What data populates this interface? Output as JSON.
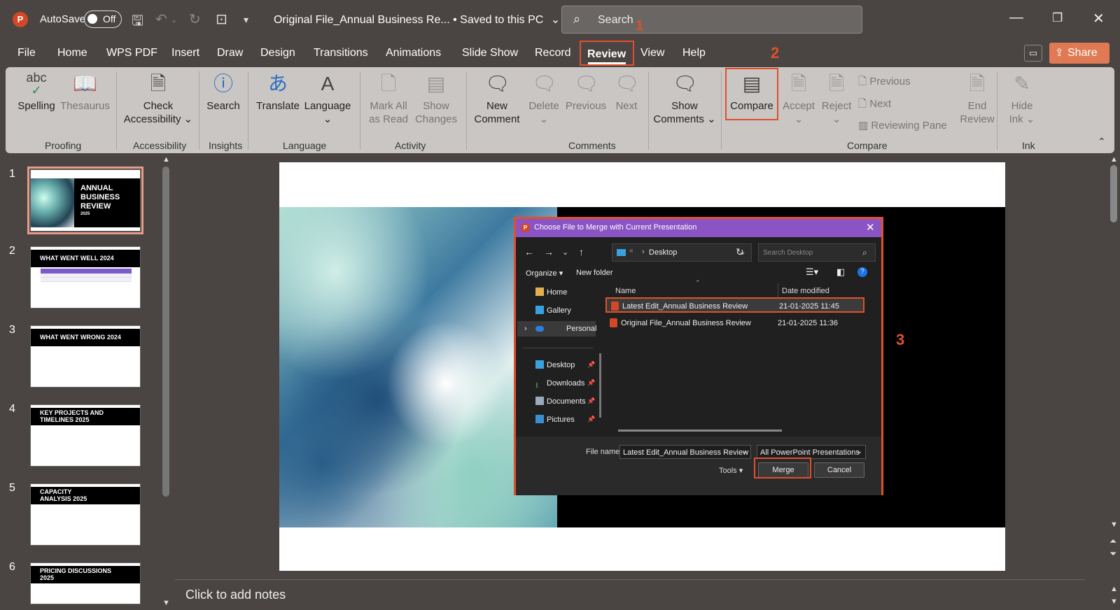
{
  "titlebar": {
    "app_logo": "P",
    "autosave_label": "AutoSave",
    "autosave_state": "Off",
    "doc_title": "Original File_Annual Business Re...  •  Saved to this PC",
    "search_placeholder": "Search",
    "annotation": "1"
  },
  "menu": {
    "tabs": [
      "File",
      "Home",
      "WPS PDF",
      "Insert",
      "Draw",
      "Design",
      "Transitions",
      "Animations",
      "Slide Show",
      "Record",
      "Review",
      "View",
      "Help"
    ],
    "active": "Review",
    "share_label": "Share",
    "annotation": "2"
  },
  "ribbon": {
    "groups": {
      "proofing": "Proofing",
      "accessibility": "Accessibility",
      "insights": "Insights",
      "language": "Language",
      "activity": "Activity",
      "comments": "Comments",
      "compare": "Compare",
      "ink": "Ink"
    },
    "buttons": {
      "spelling": "Spelling",
      "thesaurus": "Thesaurus",
      "check_accessibility_1": "Check",
      "check_accessibility_2": "Accessibility",
      "search": "Search",
      "translate": "Translate",
      "language": "Language",
      "mark_all_1": "Mark All",
      "mark_all_2": "as Read",
      "show_changes_1": "Show",
      "show_changes_2": "Changes",
      "new_comment_1": "New",
      "new_comment_2": "Comment",
      "delete": "Delete",
      "previous": "Previous",
      "next": "Next",
      "show_comments_1": "Show",
      "show_comments_2": "Comments",
      "compare": "Compare",
      "accept": "Accept",
      "reject": "Reject",
      "previous_small": "Previous",
      "next_small": "Next",
      "reviewing_pane": "Reviewing Pane",
      "end_review_1": "End",
      "end_review_2": "Review",
      "hide_ink_1": "Hide",
      "hide_ink_2": "Ink"
    },
    "spelling_icon_text": "abc"
  },
  "thumbnails": [
    {
      "num": "1",
      "title": "ANNUAL BUSINESS REVIEW",
      "year": "2025"
    },
    {
      "num": "2",
      "title": "WHAT WENT WELL 2024"
    },
    {
      "num": "3",
      "title": "WHAT WENT WRONG 2024"
    },
    {
      "num": "4",
      "title": "KEY PROJECTS AND TIMELINES 2025"
    },
    {
      "num": "5",
      "title": "CAPACITY ANALYSIS 2025"
    },
    {
      "num": "6",
      "title": "PRICING DISCUSSIONS 2025"
    }
  ],
  "dialog": {
    "title": "Choose File to Merge with Current Presentation",
    "address": "Desktop",
    "address_ellipsis": "«",
    "search_placeholder": "Search Desktop",
    "organize": "Organize",
    "new_folder": "New folder",
    "nav": {
      "home": "Home",
      "gallery": "Gallery",
      "personal": "Personal",
      "desktop": "Desktop",
      "downloads": "Downloads",
      "documents": "Documents",
      "pictures": "Pictures"
    },
    "columns": {
      "name": "Name",
      "date": "Date modified"
    },
    "files": [
      {
        "name": "Latest Edit_Annual Business Review",
        "date": "21-01-2025 11:45"
      },
      {
        "name": "Original File_Annual Business Review",
        "date": "21-01-2025 11:36"
      }
    ],
    "file_name_label": "File name:",
    "file_name_value": "Latest Edit_Annual Business Review",
    "file_type": "All PowerPoint Presentations",
    "tools": "Tools",
    "merge": "Merge",
    "cancel": "Cancel",
    "annotation": "3"
  },
  "notes_placeholder": "Click to add notes",
  "colors": {
    "accent": "#e0502a",
    "dialog_title": "#8a54c4",
    "share": "#e07a55"
  }
}
